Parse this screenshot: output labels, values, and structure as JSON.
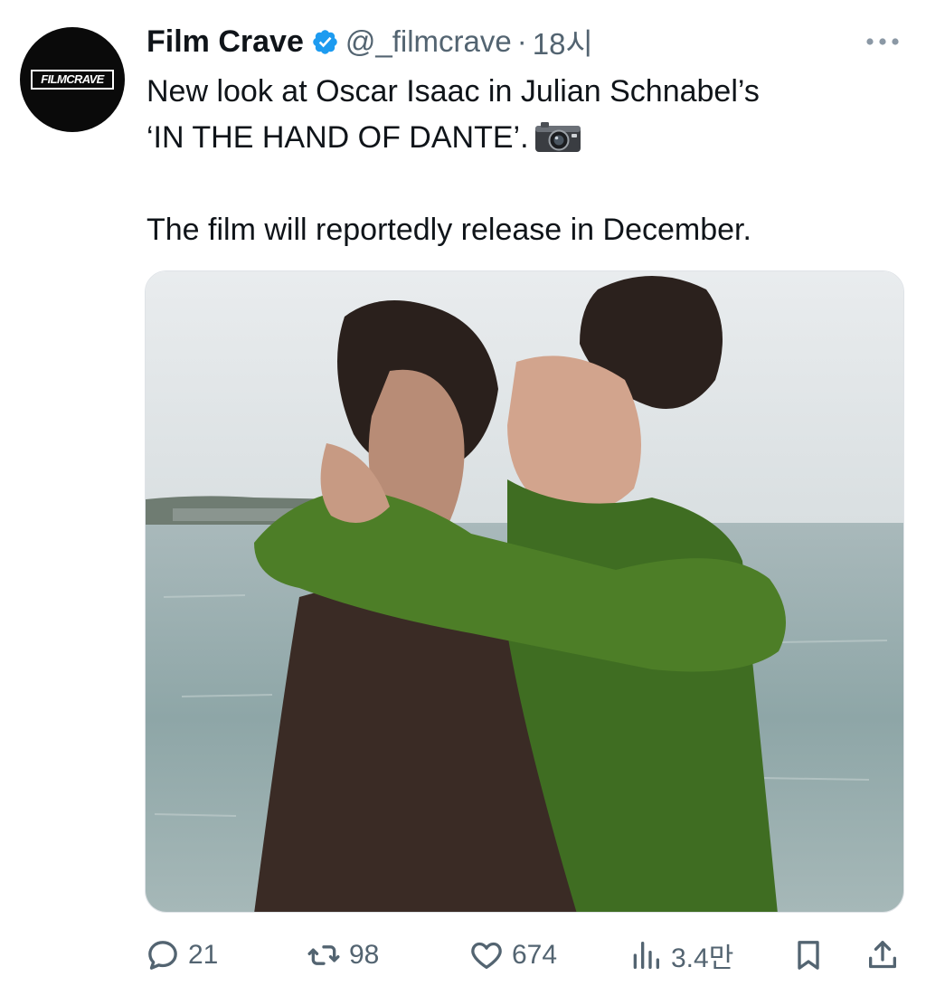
{
  "tweet": {
    "author_name": "Film Crave",
    "handle": "@_filmcrave",
    "separator": "·",
    "time": "18시",
    "avatar_text": "FILMCRAVE",
    "text_line1": "New look at Oscar Isaac in Julian Schnabel’s",
    "text_line2": "‘IN THE HAND OF DANTE’.",
    "text_line3": "The film will reportedly release in December."
  },
  "actions": {
    "replies": "21",
    "retweets": "98",
    "likes": "674",
    "views": "3.4만"
  },
  "icons": {
    "verified": "verified-badge-icon",
    "more": "more-icon",
    "camera": "camera-emoji",
    "reply": "reply-icon",
    "retweet": "retweet-icon",
    "like": "heart-icon",
    "views": "views-icon",
    "bookmark": "bookmark-icon",
    "share": "share-icon"
  },
  "colors": {
    "accent": "#1d9bf0",
    "text": "#0f1419",
    "secondary": "#536471"
  },
  "media": {
    "description": ""
  }
}
